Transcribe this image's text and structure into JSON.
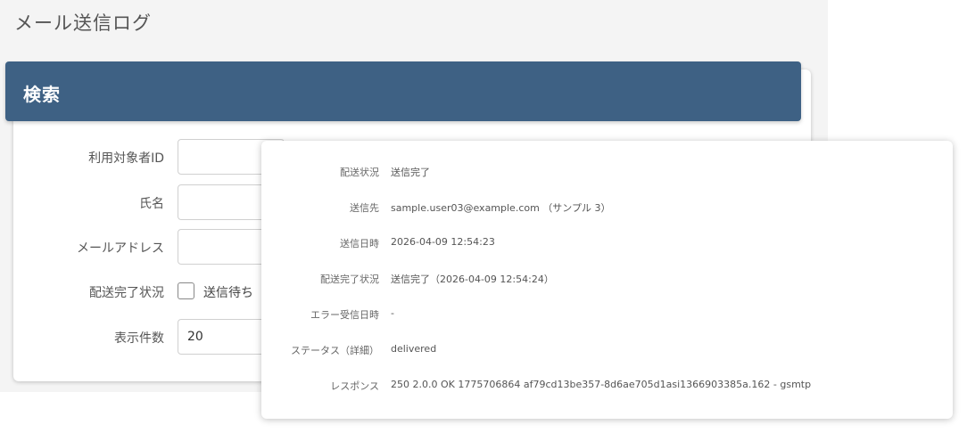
{
  "page": {
    "title": "メール送信ログ"
  },
  "search": {
    "header": "検索",
    "fields": {
      "user_id": {
        "label": "利用対象者ID",
        "value": ""
      },
      "name": {
        "label": "氏名",
        "value": ""
      },
      "email": {
        "label": "メールアドレス",
        "value": ""
      },
      "delivery_status": {
        "label": "配送完了状況",
        "option_label": "送信待ち",
        "checked": false
      },
      "page_size": {
        "label": "表示件数",
        "value": "20"
      }
    }
  },
  "detail": {
    "rows": [
      {
        "label": "配送状況",
        "value": "送信完了"
      },
      {
        "label": "送信先",
        "value": "sample.user03@example.com （サンプル 3）"
      },
      {
        "label": "送信日時",
        "value": "2026-04-09 12:54:23"
      },
      {
        "label": "配送完了状況",
        "value": "送信完了（2026-04-09 12:54:24）"
      },
      {
        "label": "エラー受信日時",
        "value": "-"
      },
      {
        "label": "ステータス（詳細）",
        "value": "delivered"
      },
      {
        "label": "レスポンス",
        "value": "250 2.0.0 OK 1775706864 af79cd13be357-8d6ae705d1asi1366903385a.162 - gsmtp"
      }
    ]
  }
}
